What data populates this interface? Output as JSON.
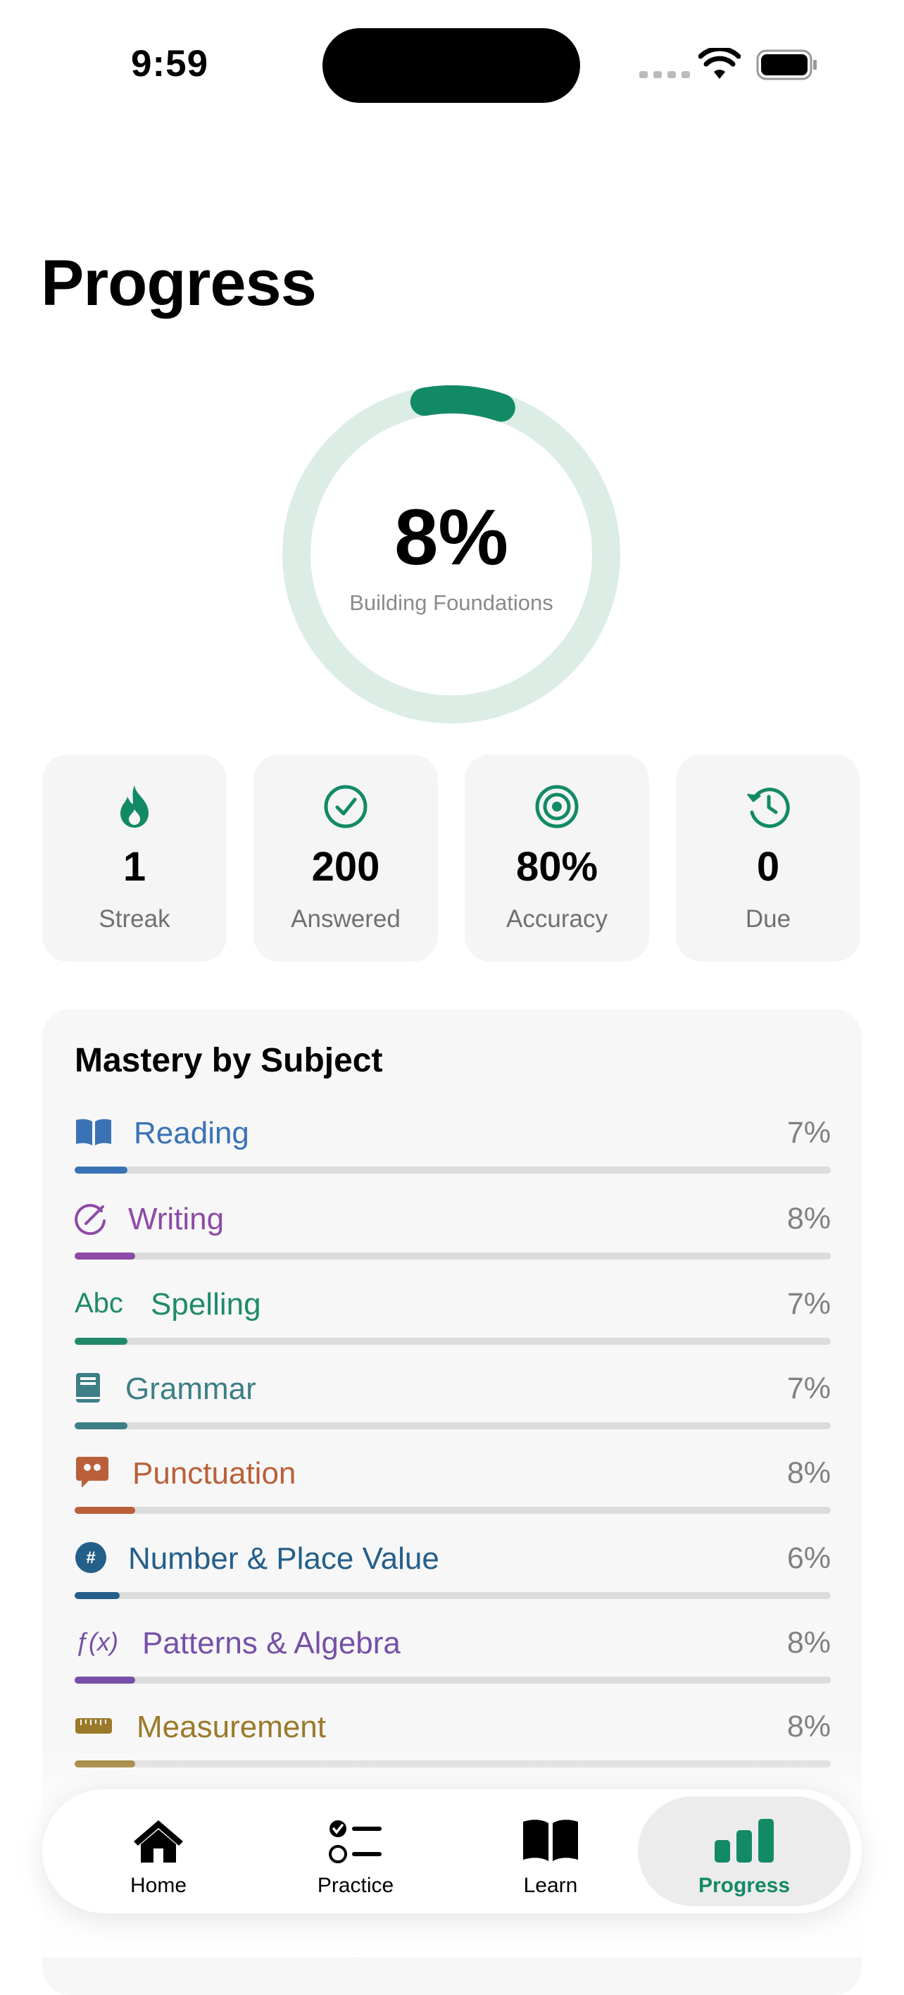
{
  "status_bar": {
    "time": "9:59"
  },
  "page": {
    "title": "Progress"
  },
  "overall": {
    "percent_label": "8%",
    "fraction": 0.08,
    "level": "Building Foundations"
  },
  "stats": [
    {
      "value": "1",
      "label": "Streak",
      "icon": "flame-icon"
    },
    {
      "value": "200",
      "label": "Answered",
      "icon": "checkmark-circle-icon"
    },
    {
      "value": "80%",
      "label": "Accuracy",
      "icon": "target-icon"
    },
    {
      "value": "0",
      "label": "Due",
      "icon": "clock-history-icon"
    }
  ],
  "mastery": {
    "title": "Mastery by Subject",
    "subjects": [
      {
        "name": "Reading",
        "percent": "7%",
        "fraction": 0.07,
        "color": "#3a73b5",
        "icon": "book-open-icon"
      },
      {
        "name": "Writing",
        "percent": "8%",
        "fraction": 0.08,
        "color": "#8e4aa6",
        "icon": "pencil-circle-icon"
      },
      {
        "name": "Spelling",
        "percent": "7%",
        "fraction": 0.07,
        "color": "#1f8a6a",
        "icon": "abc-icon",
        "icon_text": "Abc"
      },
      {
        "name": "Grammar",
        "percent": "7%",
        "fraction": 0.07,
        "color": "#3d7f86",
        "icon": "book-closed-icon"
      },
      {
        "name": "Punctuation",
        "percent": "8%",
        "fraction": 0.08,
        "color": "#b9603a",
        "icon": "quote-bubble-icon"
      },
      {
        "name": "Number & Place Value",
        "percent": "6%",
        "fraction": 0.06,
        "color": "#245f8a",
        "icon": "number-sign-icon"
      },
      {
        "name": "Patterns & Algebra",
        "percent": "8%",
        "fraction": 0.08,
        "color": "#7650a8",
        "icon": "function-icon",
        "icon_text": "ƒ(x)"
      },
      {
        "name": "Measurement",
        "percent": "8%",
        "fraction": 0.08,
        "color": "#9a7a2a",
        "icon": "ruler-icon"
      }
    ]
  },
  "tabbar": {
    "tabs": [
      {
        "label": "Home",
        "icon": "house-icon"
      },
      {
        "label": "Practice",
        "icon": "checklist-icon"
      },
      {
        "label": "Learn",
        "icon": "book-icon"
      },
      {
        "label": "Progress",
        "icon": "bar-chart-icon",
        "active": true
      }
    ]
  },
  "colors": {
    "accent": "#138a66",
    "ring_track": "#dcede6"
  }
}
